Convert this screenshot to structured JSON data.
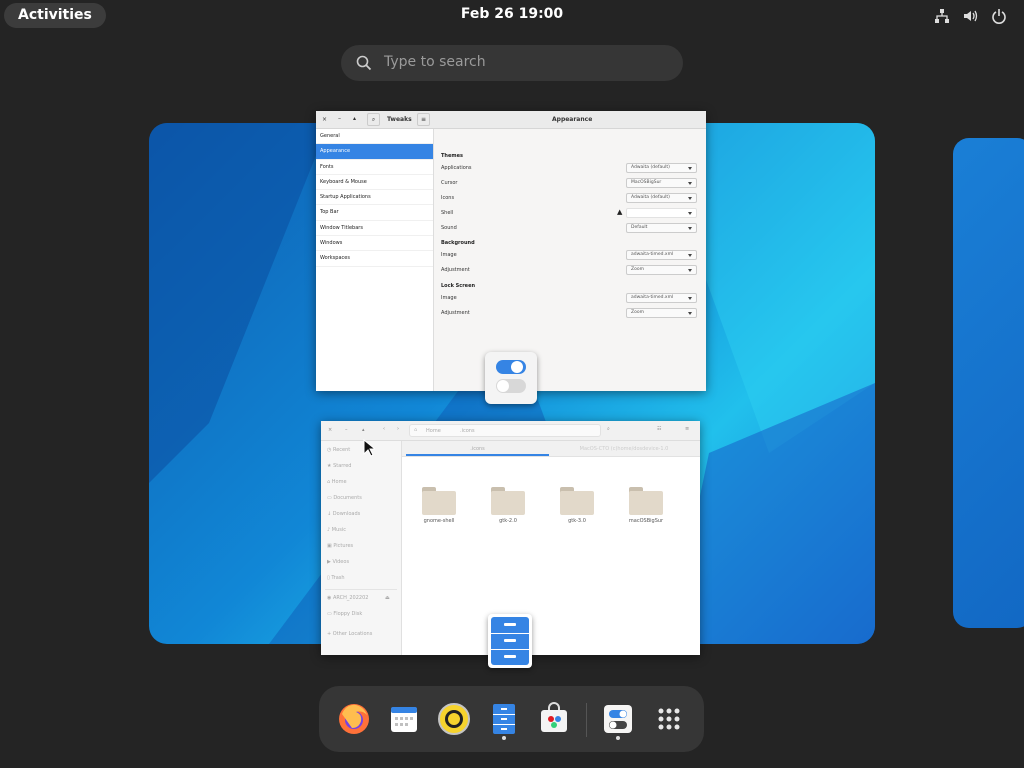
{
  "topbar": {
    "activities": "Activities",
    "clock": "Feb 26  19:00"
  },
  "search": {
    "placeholder": "Type to search"
  },
  "tweaks": {
    "tab": "Tweaks",
    "title": "Appearance",
    "sidebar": [
      "General",
      "Appearance",
      "Fonts",
      "Keyboard & Mouse",
      "Startup Applications",
      "Top Bar",
      "Window Titlebars",
      "Windows",
      "Workspaces"
    ],
    "themes_label": "Themes",
    "themes": [
      {
        "label": "Applications",
        "value": "Adwaita (default)"
      },
      {
        "label": "Cursor",
        "value": "MacOSBigSur"
      },
      {
        "label": "Icons",
        "value": "Adwaita (default)"
      },
      {
        "label": "Shell",
        "value": ""
      },
      {
        "label": "Sound",
        "value": "Default"
      }
    ],
    "background_label": "Background",
    "background": [
      {
        "label": "Image",
        "value": "adwaita-timed.xml"
      },
      {
        "label": "Adjustment",
        "value": "Zoom"
      }
    ],
    "lock_label": "Lock Screen",
    "lock": [
      {
        "label": "Image",
        "value": "adwaita-timed.xml"
      },
      {
        "label": "Adjustment",
        "value": "Zoom"
      }
    ]
  },
  "files": {
    "path_home": "Home",
    "path_dir": ".icons",
    "tab1": ".icons",
    "tab2": "MacOS-CTO (c)home/dosdevice-1.0",
    "sidebar": [
      "Recent",
      "Starred",
      "Home",
      "Documents",
      "Downloads",
      "Music",
      "Pictures",
      "Videos",
      "Trash",
      "ARCH_202202",
      "Floppy Disk",
      "Other Locations"
    ],
    "folders": [
      "gnome-shell",
      "gtk-2.0",
      "gtk-3.0",
      "macOSBigSur"
    ]
  },
  "dock": [
    "firefox-icon",
    "calendar-icon",
    "rhythmbox-icon",
    "files-icon",
    "software-icon",
    "tweaks-icon",
    "app-grid-icon"
  ]
}
